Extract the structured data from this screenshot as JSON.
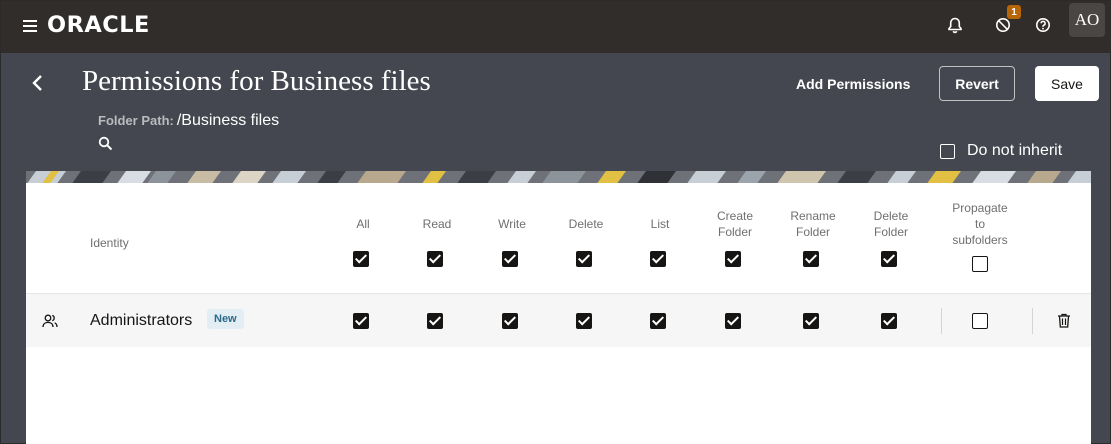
{
  "topbar": {
    "logo": "ORACLE",
    "notifications_badge": "1",
    "avatar_initials": "AO"
  },
  "header": {
    "title": "Permissions for Business files",
    "folder_path_label": "Folder Path:",
    "folder_path_value": "/Business files",
    "add_permissions_label": "Add Permissions",
    "revert_label": "Revert",
    "save_label": "Save",
    "do_not_inherit_label": "Do not inherit",
    "do_not_inherit_checked": false
  },
  "table": {
    "identity_header": "Identity",
    "columns": [
      {
        "line1": "All",
        "line2": "",
        "line3": "",
        "header_checked": true,
        "row_checked": true
      },
      {
        "line1": "Read",
        "line2": "",
        "line3": "",
        "header_checked": true,
        "row_checked": true
      },
      {
        "line1": "Write",
        "line2": "",
        "line3": "",
        "header_checked": true,
        "row_checked": true
      },
      {
        "line1": "Delete",
        "line2": "",
        "line3": "",
        "header_checked": true,
        "row_checked": true
      },
      {
        "line1": "List",
        "line2": "",
        "line3": "",
        "header_checked": true,
        "row_checked": true
      },
      {
        "line1": "Create",
        "line2": "Folder",
        "line3": "",
        "header_checked": true,
        "row_checked": true
      },
      {
        "line1": "Rename",
        "line2": "Folder",
        "line3": "",
        "header_checked": true,
        "row_checked": true
      },
      {
        "line1": "Delete",
        "line2": "Folder",
        "line3": "",
        "header_checked": true,
        "row_checked": true
      },
      {
        "line1": "Propagate",
        "line2": "to",
        "line3": "subfolders",
        "header_checked": false,
        "row_checked": false
      }
    ],
    "rows": [
      {
        "name": "Administrators",
        "badge": "New"
      }
    ]
  },
  "colors": {
    "topbar_bg": "#312d2a",
    "header_bg": "#44474f",
    "accent_badge": "#b76507"
  }
}
